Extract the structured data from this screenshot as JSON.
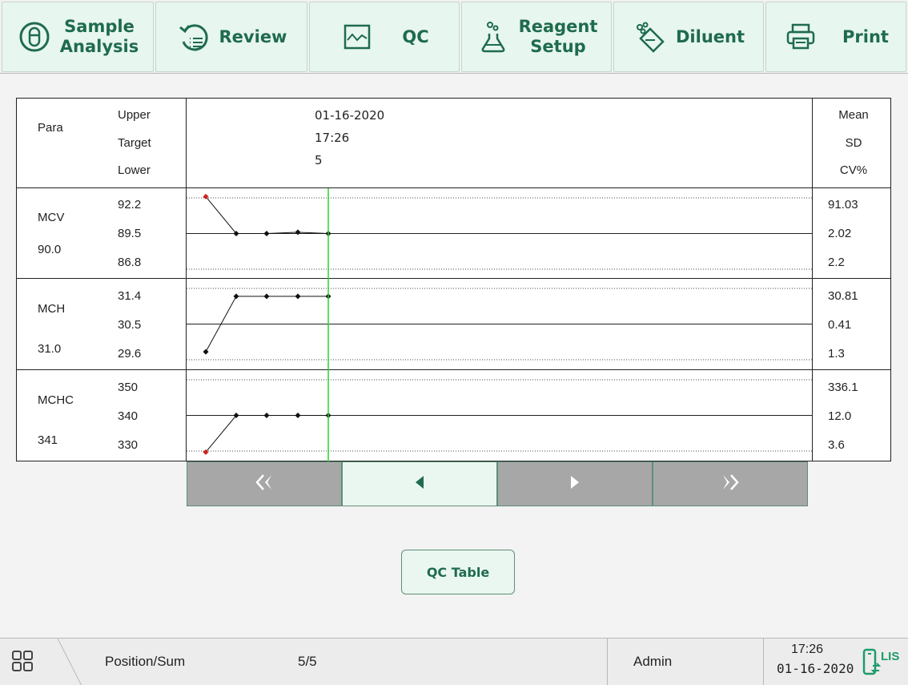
{
  "toolbar": {
    "sample_analysis": "Sample\nAnalysis",
    "review": "Review",
    "qc": "QC",
    "reagent_setup": "Reagent\nSetup",
    "diluent": "Diluent",
    "print": "Print"
  },
  "qc_header": {
    "para": "Para",
    "upper": "Upper",
    "target": "Target",
    "lower": "Lower",
    "date": "01-16-2020",
    "time": "17:26",
    "run": "5",
    "mean": "Mean",
    "sd": "SD",
    "cv": "CV%"
  },
  "qc_rows": [
    {
      "name": "MCV",
      "value": "90.0",
      "upper": "92.2",
      "target": "89.5",
      "lower": "86.8",
      "mean": "91.03",
      "sd": "2.02",
      "cv": "2.2"
    },
    {
      "name": "MCH",
      "value": "31.0",
      "upper": "31.4",
      "target": "30.5",
      "lower": "29.6",
      "mean": "30.81",
      "sd": "0.41",
      "cv": "1.3"
    },
    {
      "name": "MCHC",
      "value": "341",
      "upper": "350",
      "target": "340",
      "lower": "330",
      "mean": "336.1",
      "sd": "12.0",
      "cv": "3.6"
    }
  ],
  "chart_data": {
    "type": "line",
    "cursor_point": 5,
    "series": [
      {
        "name": "MCV",
        "limits": [
          86.8,
          92.2
        ],
        "target": 89.5,
        "values": [
          92.3,
          89.5,
          89.5,
          89.6,
          89.5
        ]
      },
      {
        "name": "MCH",
        "limits": [
          29.6,
          31.4
        ],
        "target": 30.5,
        "values": [
          29.8,
          31.2,
          31.2,
          31.2,
          31.2
        ]
      },
      {
        "name": "MCHC",
        "limits": [
          330,
          350
        ],
        "target": 340,
        "values": [
          329.7,
          340,
          340,
          340,
          340
        ]
      }
    ],
    "out_of_range_color": "#d42020",
    "in_range_color": "#111111",
    "cursor_color": "#2bd62b"
  },
  "bottom": {
    "qc_table": "QC Table"
  },
  "status": {
    "position_label": "Position/Sum",
    "position_value": "5/5",
    "user": "Admin",
    "time": "17:26",
    "date": "01-16-2020",
    "lis": "LIS"
  },
  "colors": {
    "accent": "#1f6b4e",
    "button_bg": "#e7f6ef",
    "disabled": "#a7a7a7"
  }
}
